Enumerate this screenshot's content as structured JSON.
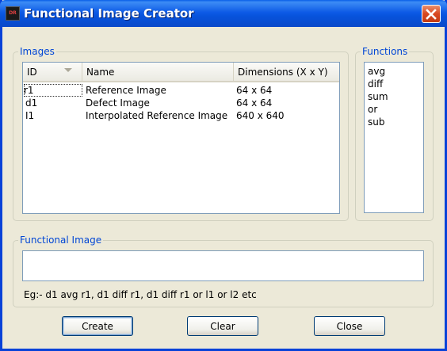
{
  "window": {
    "title": "Functional Image Creator",
    "app_icon_text": "DR",
    "accent_color": "#0842d8"
  },
  "images_group": {
    "label": "Images",
    "columns": [
      "ID",
      "Name",
      "Dimensions (X x Y)"
    ],
    "rows": [
      {
        "id": "r1",
        "name": "Reference Image",
        "dims": "64 x 64"
      },
      {
        "id": "d1",
        "name": "Defect Image",
        "dims": "64 x 64"
      },
      {
        "id": "I1",
        "name": "Interpolated Reference Image",
        "dims": "640 x 640"
      }
    ]
  },
  "functions_group": {
    "label": "Functions",
    "items": [
      "avg",
      "diff",
      "sum",
      "or",
      "sub"
    ]
  },
  "functional_image_group": {
    "label": "Functional Image",
    "value": "",
    "hint": "Eg:- d1 avg r1, d1 diff r1, d1 diff r1 or l1 or l2 etc"
  },
  "buttons": {
    "create": "Create",
    "clear": "Clear",
    "close": "Close"
  }
}
